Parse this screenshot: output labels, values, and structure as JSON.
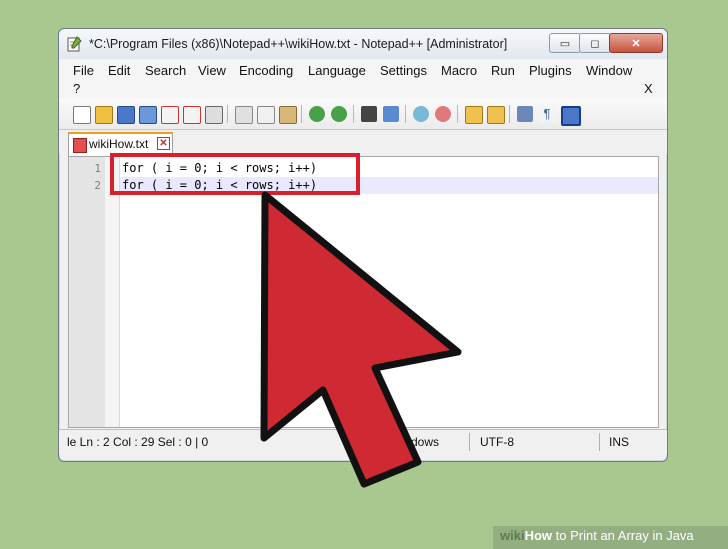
{
  "window": {
    "title": "*C:\\Program Files (x86)\\Notepad++\\wikiHow.txt - Notepad++ [Administrator]",
    "min_glyph": "▭",
    "max_glyph": "◻",
    "close_glyph": "✕"
  },
  "menu": {
    "items": [
      "File",
      "Edit",
      "Search",
      "View",
      "Encoding",
      "Language",
      "Settings",
      "Macro",
      "Run",
      "Plugins",
      "Window",
      "?"
    ],
    "close_x": "X"
  },
  "tab": {
    "label": "wikiHow.txt",
    "close_glyph": "✕"
  },
  "editor": {
    "line_numbers": [
      "1",
      "2"
    ],
    "lines": [
      "for ( i = 0; i < rows; i++)",
      "for ( i = 0; i < rows; i++)"
    ]
  },
  "status": {
    "position": "le Ln : 2    Col : 29    Sel : 0 | 0",
    "eol": "dows",
    "encoding": "UTF-8",
    "mode": "INS"
  },
  "footer": {
    "wiki": "wiki",
    "how": "How",
    "rest": " to Print an Array in Java"
  },
  "colors": {
    "highlight": "#d8202a",
    "arrow_fill": "#cf2a33",
    "arrow_outline": "#111111",
    "background": "#a8c890"
  }
}
